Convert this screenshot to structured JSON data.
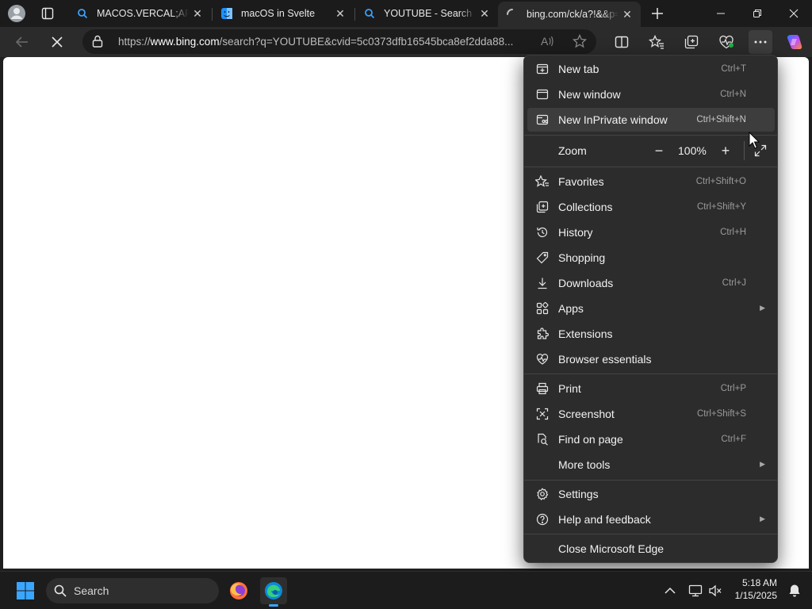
{
  "tabs": [
    {
      "title": "MACOS.VERCAL;APP - Search",
      "favicon": "bing-search-icon"
    },
    {
      "title": "macOS in Svelte",
      "favicon": "finder-icon"
    },
    {
      "title": "YOUTUBE - Search",
      "favicon": "bing-search-icon"
    },
    {
      "title": "bing.com/ck/a?!&&p=",
      "favicon": "loading-spinner-icon",
      "active": true
    }
  ],
  "address": {
    "prefix": "https://",
    "domain": "www.bing.com",
    "path": "/search?q=YOUTUBE&cvid=5c0373dfb16545bca8ef2dda88..."
  },
  "menu": {
    "items": [
      {
        "id": "new-tab",
        "label": "New tab",
        "shortcut": "Ctrl+T",
        "icon": "new-tab-icon"
      },
      {
        "id": "new-window",
        "label": "New window",
        "shortcut": "Ctrl+N",
        "icon": "new-window-icon"
      },
      {
        "id": "new-inprivate-window",
        "label": "New InPrivate window",
        "shortcut": "Ctrl+Shift+N",
        "icon": "inprivate-icon",
        "highlighted": true
      },
      {
        "id": "favorites",
        "label": "Favorites",
        "shortcut": "Ctrl+Shift+O",
        "icon": "favorites-icon"
      },
      {
        "id": "collections",
        "label": "Collections",
        "shortcut": "Ctrl+Shift+Y",
        "icon": "collections-icon"
      },
      {
        "id": "history",
        "label": "History",
        "shortcut": "Ctrl+H",
        "icon": "history-icon"
      },
      {
        "id": "shopping",
        "label": "Shopping",
        "shortcut": "",
        "icon": "shopping-tag-icon"
      },
      {
        "id": "downloads",
        "label": "Downloads",
        "shortcut": "Ctrl+J",
        "icon": "download-icon"
      },
      {
        "id": "apps",
        "label": "Apps",
        "shortcut": "",
        "icon": "apps-icon",
        "submenu": true
      },
      {
        "id": "extensions",
        "label": "Extensions",
        "shortcut": "",
        "icon": "extensions-icon"
      },
      {
        "id": "browser-essentials",
        "label": "Browser essentials",
        "shortcut": "",
        "icon": "heart-pulse-icon"
      },
      {
        "id": "print",
        "label": "Print",
        "shortcut": "Ctrl+P",
        "icon": "printer-icon"
      },
      {
        "id": "screenshot",
        "label": "Screenshot",
        "shortcut": "Ctrl+Shift+S",
        "icon": "screenshot-icon"
      },
      {
        "id": "find-on-page",
        "label": "Find on page",
        "shortcut": "Ctrl+F",
        "icon": "find-icon"
      },
      {
        "id": "more-tools",
        "label": "More tools",
        "shortcut": "",
        "icon": "",
        "submenu": true
      },
      {
        "id": "settings",
        "label": "Settings",
        "shortcut": "",
        "icon": "gear-icon"
      },
      {
        "id": "help-and-feedback",
        "label": "Help and feedback",
        "shortcut": "",
        "icon": "help-icon",
        "submenu": true
      },
      {
        "id": "close-microsoft-edge",
        "label": "Close Microsoft Edge",
        "shortcut": "",
        "icon": ""
      }
    ],
    "zoom": {
      "label": "Zoom",
      "value": "100%"
    }
  },
  "taskbar": {
    "search_label": "Search",
    "time": "5:18 AM",
    "date": "1/15/2025"
  },
  "colors": {
    "accent": "#0078d4",
    "menu_bg": "#2c2c2c",
    "highlight": "#3d3d3d"
  }
}
